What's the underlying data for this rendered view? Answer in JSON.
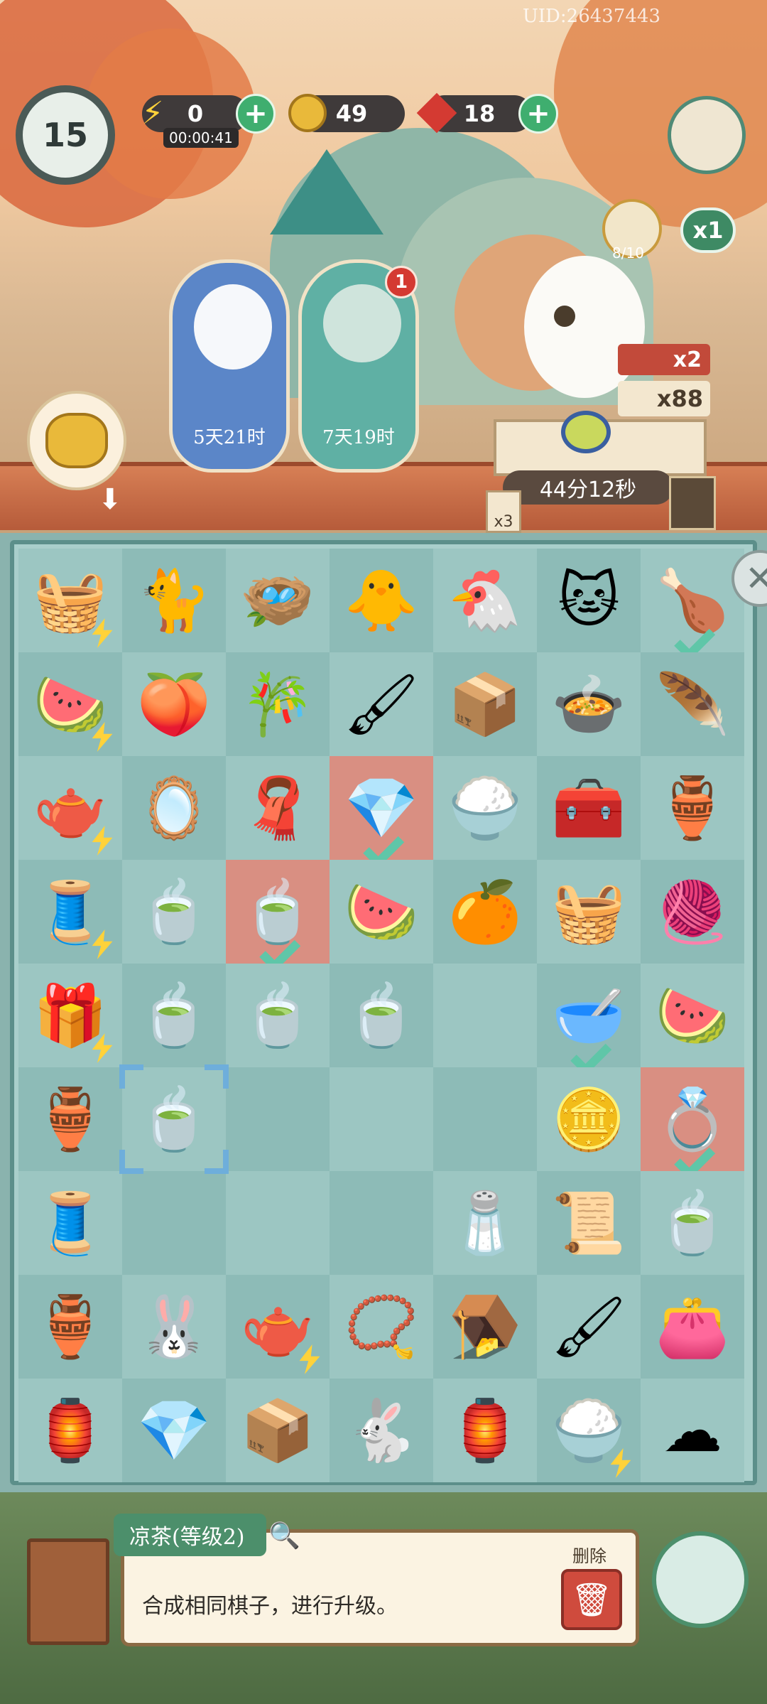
{
  "header": {
    "uid": "UID:26437443",
    "level": "15",
    "energy": {
      "value": "0",
      "timer": "00:00:41"
    },
    "coins": "49",
    "gems": "18"
  },
  "events": [
    {
      "label": "5天21时"
    },
    {
      "label": "7天19时",
      "badge": "1"
    }
  ],
  "order": {
    "progress": "8/10",
    "multiplier": "x1",
    "reward_cats": "x2",
    "reward_coins": "x88",
    "timer": "44分12秒",
    "stack_count": "x3"
  },
  "info_panel": {
    "title": "凉茶(等级2)",
    "description": "合成相同棋子，进行升级。",
    "delete_label": "删除"
  },
  "colors": {
    "board_bg": "#a9cfcb",
    "cell": "#9cc6c2",
    "highlight": "#d98f82",
    "accent_green": "#3fae6f",
    "gem_red": "#d43a32"
  },
  "board": [
    [
      "basket-yarn",
      "sleeping-cat",
      "nest",
      "chick-nest",
      "hen",
      "calico-cat",
      "roast-chicken"
    ],
    [
      "fruit-basket",
      "peach-bun",
      "bamboo",
      "brush-ruler",
      "tea-box",
      "soup-bowl",
      "feather"
    ],
    [
      "teapot",
      "hand-mirror",
      "cloth",
      "earrings",
      "fried-rice",
      "wooden-chest",
      "jar"
    ],
    [
      "spinning-wheel",
      "tea-tray",
      "teacup-lid",
      "watermelon",
      "fruit-board",
      "woven-basket",
      "thread-spools"
    ],
    [
      "treasure-chest",
      "tea-cup-blue",
      "tea-cup",
      "tea-saucer",
      "",
      "green-bowl",
      "watermelon-plate"
    ],
    [
      "energy-gourd",
      "empty-cup",
      "",
      "",
      "",
      "copper-coin",
      "gold-ring"
    ],
    [
      "thread-spool",
      "",
      "",
      "",
      "salt-board",
      "red-scrolls",
      "tea-bowl"
    ],
    [
      "green-gourd",
      "rabbit-cake",
      "teapot-small",
      "jade-bracelet",
      "birdcage",
      "brush-bundle",
      "silk-pouch"
    ],
    [
      "lantern",
      "earrings-blue",
      "brush-box",
      "rabbit-bowl",
      "paper-lantern",
      "rice-bowl",
      "cloud-pendant"
    ]
  ]
}
